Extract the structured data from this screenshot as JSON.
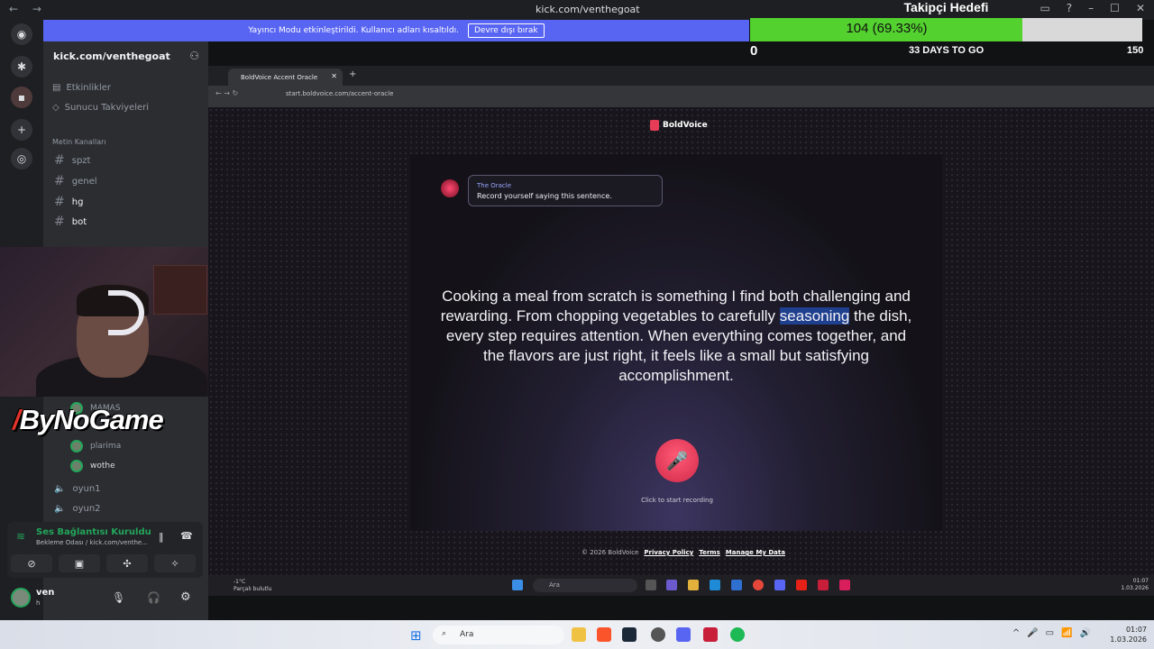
{
  "titlebar": {
    "url": "kick.com/venthegoat",
    "nav": "← →"
  },
  "banner": {
    "text": "Yayıncı Modu etkinleştirildi. Kullanıcı adları kısaltıldı.",
    "button": "Devre dışı bırak"
  },
  "goal": {
    "title": "Takipçi Hedefi",
    "progress_text": "104 (69.33%)",
    "progress": 0.6933,
    "min": "0",
    "days": "33 DAYS TO GO",
    "max": "150"
  },
  "sidebar": {
    "server_name": "kick.com/venthegoat",
    "events": "Etkinlikler",
    "boosts": "Sunucu Takviyeleri",
    "text_channels_header": "Metin Kanalları",
    "channels": [
      "spzt",
      "genel",
      "hg",
      "bot"
    ],
    "voice_users": [
      "MAMAS",
      "plarima",
      "wothe"
    ],
    "voice_channels": [
      "oyun1",
      "oyun2"
    ]
  },
  "overlay": {
    "logo": "ByNoGame"
  },
  "voice_panel": {
    "status": "Ses Bağlantısı Kuruldu",
    "sub": "Bekleme Odası / kick.com/venthe..."
  },
  "user_panel": {
    "name": "ven",
    "status": "h"
  },
  "browser": {
    "tab_title": "BoldVoice Accent Oracle",
    "address": "start.boldvoice.com/accent-oracle",
    "brand": "BoldVoice",
    "oracle_name": "The Oracle",
    "oracle_msg": "Record yourself saying this sentence.",
    "sentence_pre": "Cooking a meal from scratch is something I find both challenging and rewarding. From chopping vegetables to carefully ",
    "sentence_highlight": "seasoning",
    "sentence_post": " the dish, every step requires attention. When everything comes together, and the flavors are just right, it feels like a small but satisfying accomplishment.",
    "mic_label": "Click to start recording",
    "footer_copy": "© 2026 BoldVoice",
    "footer_links": [
      "Privacy Policy",
      "Terms",
      "Manage My Data"
    ]
  },
  "inner_taskbar": {
    "search": "Ara",
    "weather_temp": "-1°C",
    "weather_text": "Parçalı bulutlu",
    "time": "01:07",
    "date": "1.03.2026"
  },
  "taskbar": {
    "search": "Ara",
    "time": "01:07",
    "date": "1.03.2026"
  },
  "colors": {
    "discord_blurple": "#5865f2",
    "goal_green": "#53d12f",
    "voice_green": "#23a55a",
    "mic_red": "#e63c58"
  }
}
